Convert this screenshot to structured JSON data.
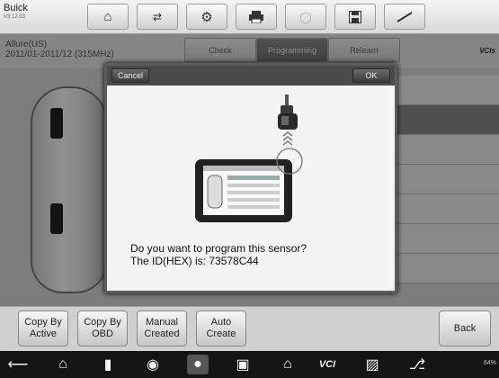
{
  "app": {
    "brand": "Buick",
    "version": "V3.12.03"
  },
  "toolbar": {
    "icons": [
      "home-icon",
      "vehicle-swap-icon",
      "gear-icon",
      "printer-icon",
      "disabled-icon",
      "save-icon",
      "pen-icon"
    ]
  },
  "vehicle": {
    "model": "Allure(US)",
    "range": "2011/01-2011/12 (315MHz)"
  },
  "tabs": [
    {
      "label": "Check",
      "active": false
    },
    {
      "label": "Programming",
      "active": true
    },
    {
      "label": "Relearn",
      "active": false
    }
  ],
  "vci": "VCIs",
  "dialog": {
    "cancel_label": "Cancel",
    "ok_label": "OK",
    "message_line1": "Do you want to program this sensor?",
    "message_line2": "The ID(HEX) is: 73578C44"
  },
  "functions": [
    {
      "label": "Copy By Active"
    },
    {
      "label": "Copy By OBD"
    },
    {
      "label": "Manual Created"
    },
    {
      "label": "Auto Create"
    }
  ],
  "back_label": "Back",
  "status": {
    "text": "64%"
  },
  "navbar_icons": [
    "back-icon",
    "home-icon",
    "recent-apps-icon",
    "chrome-icon",
    "camera-icon",
    "screen-record-icon",
    "maxisys-icon",
    "vci-icon",
    "car-icon",
    "usb-icon"
  ]
}
